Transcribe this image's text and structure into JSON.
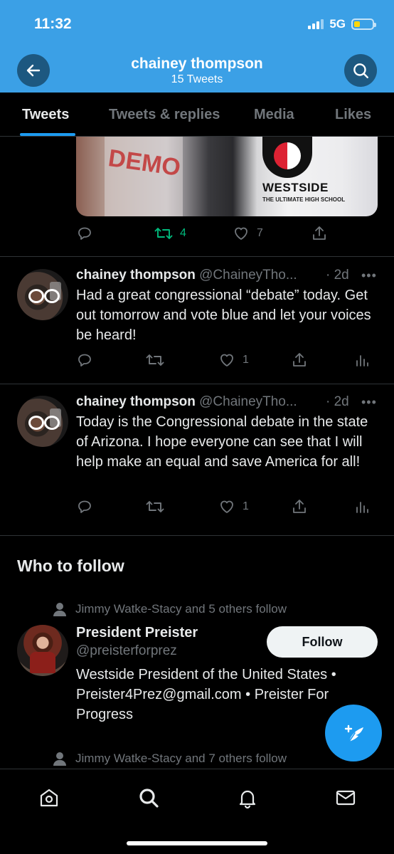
{
  "status_bar": {
    "time": "11:32",
    "network": "5G",
    "battery_color": "#ffd60a"
  },
  "header": {
    "title": "chainey thompson",
    "subtitle": "15 Tweets",
    "back_icon": "arrow-left-icon",
    "search_icon": "search-icon",
    "background": "#3ba0e6"
  },
  "tabs": [
    {
      "label": "Tweets",
      "active": true
    },
    {
      "label": "Tweets & replies",
      "active": false
    },
    {
      "label": "Media",
      "active": false
    },
    {
      "label": "Likes",
      "active": false
    }
  ],
  "top_tweet": {
    "photo_text": {
      "shirt": "DEMO",
      "school": "WESTSIDE",
      "motto": "THE ULTIMATE HIGH SCHOOL"
    },
    "retweets": "4",
    "likes": "7"
  },
  "tweets": [
    {
      "name": "chainey thompson",
      "handle": "@ChaineyTho...",
      "time": "· 2d",
      "more": "•••",
      "text": "Had a great congressional “debate” today. Get out tomorrow and vote blue and let your voices be heard!",
      "likes": "1"
    },
    {
      "name": "chainey thompson",
      "handle": "@ChaineyTho...",
      "time": "· 2d",
      "more": "•••",
      "text": "Today is the Congressional debate in the state of Arizona. I hope everyone can see that I will help make an equal and save America for all!",
      "likes": "1"
    }
  ],
  "who_to_follow": {
    "title": "Who to follow",
    "suggestions": [
      {
        "social_context": "Jimmy Watke-Stacy and 5 others follow",
        "name": "President Preister",
        "handle": "@preisterforprez",
        "bio": "Westside President of the United States • Preister4Prez@gmail.com • Preister For Progress",
        "button": "Follow"
      },
      {
        "social_context": "Jimmy Watke-Stacy and 7 others follow"
      }
    ]
  },
  "fab": {
    "icon": "compose-feather-icon"
  },
  "bottom_nav": [
    "home-icon",
    "search-icon",
    "notifications-bell-icon",
    "messages-envelope-icon"
  ]
}
